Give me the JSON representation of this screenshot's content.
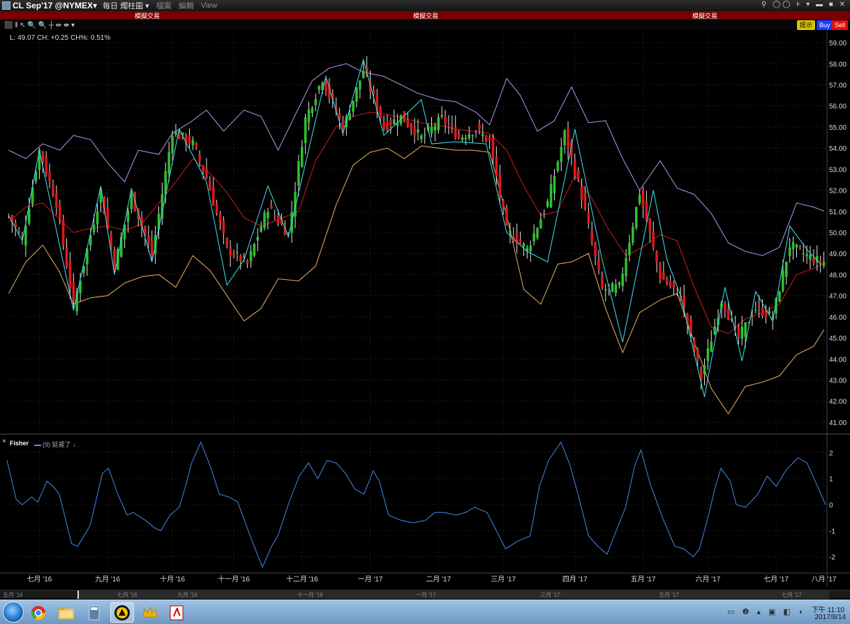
{
  "window": {
    "symbol": "CL Sep'17 @NYMEX▾",
    "chart_type_menu": "每日 燭柱圖 ▾",
    "menu": [
      "檔案",
      "編輯",
      "View"
    ],
    "controls": "⚲ ◯◯ ⊧ ▾ ▬ ■ ✕"
  },
  "sim_banner": [
    "模擬交易",
    "模擬交易",
    "模擬交易"
  ],
  "toolbar": {
    "tools": "⬛ ⫴ ↖ 🔍 🔍 ┼ ⇹ ⇼ ▾",
    "hint": "提示",
    "buy": "Buy",
    "sell": "Sell"
  },
  "readout": "L: 49.07  CH: +0.25  CH%: 0.51%",
  "indicator": {
    "name": "Fisher",
    "param": "(9) 延遲了 ↓",
    "close": "×"
  },
  "chart_data": [
    {
      "type": "candlestick",
      "ylim": [
        40.5,
        59.5
      ],
      "yticks": [
        "59.00",
        "58.00",
        "57.00",
        "56.00",
        "55.00",
        "54.00",
        "53.00",
        "52.00",
        "51.00",
        "50.00",
        "49.00",
        "48.00",
        "47.00",
        "46.00",
        "45.00",
        "44.00",
        "43.00",
        "42.00",
        "41.00"
      ],
      "xticks": [
        "七月 '16",
        "九月 '16",
        "十月 '16",
        "十一月 '16",
        "十二月 '16",
        "一月 '17",
        "二月 '17",
        "三月 '17",
        "四月 '17",
        "五月 '17",
        "六月 '17",
        "七月 '17",
        "八月 '17"
      ],
      "colors": {
        "up": "#2ec22e",
        "down": "#e01818",
        "mid": "#c01a1a",
        "upper": "#a88ad8",
        "lower": "#d9a55a",
        "zigzag": "#40d0e0"
      },
      "close_anchors": [
        [
          0,
          50.8
        ],
        [
          4,
          49.6
        ],
        [
          9,
          53.9
        ],
        [
          14,
          51.4
        ],
        [
          19,
          46.5
        ],
        [
          27,
          51.9
        ],
        [
          31,
          48.4
        ],
        [
          36,
          51.7
        ],
        [
          42,
          48.9
        ],
        [
          48,
          54.8
        ],
        [
          54,
          54.2
        ],
        [
          58,
          52.6
        ],
        [
          64,
          49.2
        ],
        [
          70,
          48.5
        ],
        [
          76,
          51.2
        ],
        [
          82,
          49.9
        ],
        [
          87,
          55.4
        ],
        [
          92,
          57.3
        ],
        [
          98,
          54.9
        ],
        [
          104,
          57.7
        ],
        [
          110,
          55.0
        ],
        [
          115,
          55.5
        ],
        [
          121,
          54.5
        ],
        [
          127,
          55.4
        ],
        [
          132,
          54.5
        ],
        [
          137,
          54.9
        ],
        [
          141,
          54.3
        ],
        [
          146,
          50.1
        ],
        [
          152,
          49.2
        ],
        [
          158,
          51.4
        ],
        [
          163,
          54.7
        ],
        [
          168,
          51.7
        ],
        [
          174,
          47.3
        ],
        [
          179,
          47.4
        ],
        [
          185,
          51.9
        ],
        [
          191,
          47.9
        ],
        [
          197,
          47.0
        ],
        [
          203,
          43.1
        ],
        [
          209,
          46.8
        ],
        [
          214,
          45.0
        ],
        [
          219,
          46.4
        ],
        [
          224,
          46.0
        ],
        [
          229,
          49.4
        ],
        [
          234,
          48.9
        ],
        [
          238,
          48.6
        ]
      ],
      "upper_band": [
        [
          0,
          53.9
        ],
        [
          5,
          53.5
        ],
        [
          10,
          54.2
        ],
        [
          15,
          53.9
        ],
        [
          19,
          54.6
        ],
        [
          24,
          54.4
        ],
        [
          29,
          53.3
        ],
        [
          34,
          52.4
        ],
        [
          38,
          53.9
        ],
        [
          44,
          53.7
        ],
        [
          48,
          54.7
        ],
        [
          53,
          55.2
        ],
        [
          58,
          55.8
        ],
        [
          63,
          54.8
        ],
        [
          69,
          55.8
        ],
        [
          74,
          55.5
        ],
        [
          79,
          53.9
        ],
        [
          85,
          55.9
        ],
        [
          89,
          57.2
        ],
        [
          94,
          57.8
        ],
        [
          99,
          58.0
        ],
        [
          104,
          57.6
        ],
        [
          110,
          57.4
        ],
        [
          115,
          57.0
        ],
        [
          120,
          56.6
        ],
        [
          126,
          56.3
        ],
        [
          131,
          56.2
        ],
        [
          137,
          55.7
        ],
        [
          141,
          55.1
        ],
        [
          146,
          57.3
        ],
        [
          150,
          56.5
        ],
        [
          155,
          54.8
        ],
        [
          160,
          55.3
        ],
        [
          165,
          56.9
        ],
        [
          170,
          55.2
        ],
        [
          175,
          55.3
        ],
        [
          180,
          53.5
        ],
        [
          185,
          52.0
        ],
        [
          191,
          53.4
        ],
        [
          196,
          52.1
        ],
        [
          201,
          51.8
        ],
        [
          206,
          50.9
        ],
        [
          211,
          49.5
        ],
        [
          216,
          49.1
        ],
        [
          221,
          48.9
        ],
        [
          226,
          49.3
        ],
        [
          231,
          51.4
        ],
        [
          236,
          51.2
        ],
        [
          241,
          50.9
        ]
      ],
      "lower_band": [
        [
          0,
          47.1
        ],
        [
          5,
          48.6
        ],
        [
          10,
          49.4
        ],
        [
          15,
          48.1
        ],
        [
          19,
          46.6
        ],
        [
          24,
          46.9
        ],
        [
          29,
          47.0
        ],
        [
          34,
          47.6
        ],
        [
          39,
          47.9
        ],
        [
          44,
          48.0
        ],
        [
          49,
          47.4
        ],
        [
          54,
          48.9
        ],
        [
          59,
          48.2
        ],
        [
          64,
          47.0
        ],
        [
          69,
          45.8
        ],
        [
          74,
          46.4
        ],
        [
          79,
          47.8
        ],
        [
          85,
          47.7
        ],
        [
          90,
          48.4
        ],
        [
          96,
          51.3
        ],
        [
          101,
          53.2
        ],
        [
          106,
          53.8
        ],
        [
          111,
          54.0
        ],
        [
          116,
          53.5
        ],
        [
          121,
          54.1
        ],
        [
          126,
          54.0
        ],
        [
          131,
          53.9
        ],
        [
          136,
          53.9
        ],
        [
          141,
          53.8
        ],
        [
          146,
          50.8
        ],
        [
          151,
          47.3
        ],
        [
          156,
          46.6
        ],
        [
          161,
          48.5
        ],
        [
          165,
          48.6
        ],
        [
          170,
          49.0
        ],
        [
          175,
          46.4
        ],
        [
          180,
          44.3
        ],
        [
          185,
          46.2
        ],
        [
          191,
          46.8
        ],
        [
          196,
          47.1
        ],
        [
          201,
          44.8
        ],
        [
          206,
          42.6
        ],
        [
          211,
          41.4
        ],
        [
          216,
          42.7
        ],
        [
          221,
          42.9
        ],
        [
          226,
          43.2
        ],
        [
          231,
          44.2
        ],
        [
          236,
          44.6
        ],
        [
          241,
          45.9
        ]
      ],
      "mid_band": [
        [
          0,
          50.5
        ],
        [
          5,
          51.2
        ],
        [
          10,
          51.4
        ],
        [
          15,
          50.6
        ],
        [
          19,
          50.0
        ],
        [
          24,
          50.2
        ],
        [
          29,
          50.3
        ],
        [
          34,
          50.1
        ],
        [
          39,
          50.4
        ],
        [
          44,
          51.4
        ],
        [
          49,
          52.4
        ],
        [
          54,
          53.5
        ],
        [
          59,
          52.8
        ],
        [
          64,
          51.9
        ],
        [
          69,
          50.7
        ],
        [
          74,
          50.3
        ],
        [
          79,
          50.6
        ],
        [
          85,
          51.0
        ],
        [
          90,
          53.4
        ],
        [
          96,
          55.0
        ],
        [
          101,
          55.5
        ],
        [
          106,
          55.7
        ],
        [
          111,
          55.6
        ],
        [
          116,
          55.4
        ],
        [
          121,
          55.2
        ],
        [
          126,
          55.1
        ],
        [
          131,
          54.9
        ],
        [
          136,
          54.8
        ],
        [
          141,
          54.7
        ],
        [
          146,
          53.9
        ],
        [
          151,
          52.2
        ],
        [
          156,
          50.8
        ],
        [
          161,
          51.0
        ],
        [
          166,
          52.7
        ],
        [
          171,
          51.6
        ],
        [
          176,
          50.1
        ],
        [
          181,
          48.9
        ],
        [
          186,
          49.3
        ],
        [
          191,
          49.9
        ],
        [
          196,
          49.6
        ],
        [
          201,
          47.4
        ],
        [
          206,
          45.5
        ],
        [
          211,
          45.2
        ],
        [
          216,
          45.9
        ],
        [
          221,
          46.2
        ],
        [
          226,
          46.6
        ],
        [
          231,
          48.0
        ],
        [
          236,
          48.3
        ],
        [
          241,
          48.7
        ]
      ],
      "zigzag": [
        [
          0,
          50.8
        ],
        [
          4,
          49.6
        ],
        [
          9,
          53.9
        ],
        [
          19,
          46.3
        ],
        [
          27,
          52.2
        ],
        [
          31,
          48.0
        ],
        [
          36,
          52.1
        ],
        [
          42,
          48.6
        ],
        [
          50,
          54.9
        ],
        [
          58,
          52.4
        ],
        [
          64,
          47.5
        ],
        [
          69,
          48.7
        ],
        [
          76,
          52.2
        ],
        [
          82,
          49.8
        ],
        [
          93,
          57.4
        ],
        [
          98,
          54.7
        ],
        [
          104,
          58.2
        ],
        [
          110,
          54.6
        ],
        [
          121,
          56.3
        ],
        [
          124,
          54.2
        ],
        [
          131,
          54.3
        ],
        [
          140,
          54.2
        ],
        [
          146,
          50.0
        ],
        [
          152,
          49.1
        ],
        [
          158,
          48.6
        ],
        [
          166,
          54.9
        ],
        [
          174,
          48.7
        ],
        [
          180,
          44.8
        ],
        [
          189,
          52.0
        ],
        [
          193,
          48.7
        ],
        [
          197,
          47.0
        ],
        [
          204,
          42.2
        ],
        [
          210,
          47.4
        ],
        [
          215,
          43.9
        ],
        [
          219,
          47.2
        ],
        [
          224,
          45.8
        ],
        [
          229,
          50.3
        ],
        [
          234,
          49.2
        ],
        [
          238,
          48.5
        ]
      ]
    },
    {
      "type": "line",
      "ylim": [
        -2.6,
        2.6
      ],
      "yticks": [
        "2",
        "1",
        "0",
        "-1",
        "-2"
      ],
      "series": [
        {
          "color": "#3a7fd6",
          "values_anchors": [
            [
              0,
              1.7
            ],
            [
              3,
              0.2
            ],
            [
              5,
              0.0
            ],
            [
              8,
              0.3
            ],
            [
              10,
              0.1
            ],
            [
              13,
              0.9
            ],
            [
              15,
              0.7
            ],
            [
              17,
              0.4
            ],
            [
              21,
              -1.5
            ],
            [
              23,
              -1.6
            ],
            [
              27,
              -0.8
            ],
            [
              31,
              1.2
            ],
            [
              33,
              1.4
            ],
            [
              36,
              0.4
            ],
            [
              39,
              -0.4
            ],
            [
              41,
              -0.3
            ],
            [
              45,
              -0.6
            ],
            [
              48,
              -0.9
            ],
            [
              50,
              -1.0
            ],
            [
              53,
              -0.4
            ],
            [
              56,
              -0.1
            ],
            [
              58,
              0.7
            ],
            [
              60,
              1.6
            ],
            [
              63,
              2.4
            ],
            [
              66,
              1.5
            ],
            [
              69,
              0.4
            ],
            [
              72,
              0.3
            ],
            [
              75,
              0.1
            ],
            [
              79,
              -1.2
            ],
            [
              83,
              -2.4
            ],
            [
              86,
              -1.6
            ],
            [
              88,
              -1.2
            ],
            [
              92,
              0.2
            ],
            [
              95,
              1.1
            ],
            [
              98,
              1.6
            ],
            [
              101,
              1.0
            ],
            [
              104,
              1.7
            ],
            [
              107,
              1.6
            ],
            [
              110,
              1.2
            ],
            [
              113,
              0.6
            ],
            [
              116,
              0.4
            ],
            [
              119,
              1.3
            ],
            [
              121,
              0.9
            ],
            [
              124,
              -0.4
            ],
            [
              128,
              -0.6
            ],
            [
              132,
              -0.7
            ],
            [
              136,
              -0.6
            ],
            [
              139,
              -0.3
            ],
            [
              142,
              -0.3
            ],
            [
              146,
              -0.4
            ],
            [
              149,
              -0.3
            ],
            [
              152,
              -0.1
            ],
            [
              156,
              -0.3
            ],
            [
              159,
              -1.0
            ],
            [
              162,
              -1.7
            ],
            [
              166,
              -1.4
            ],
            [
              170,
              -1.2
            ],
            [
              173,
              0.7
            ],
            [
              176,
              1.7
            ],
            [
              180,
              2.4
            ],
            [
              183,
              1.5
            ],
            [
              186,
              0.2
            ],
            [
              189,
              -1.2
            ],
            [
              192,
              -1.6
            ],
            [
              195,
              -1.9
            ],
            [
              197,
              -1.3
            ],
            [
              201,
              -0.1
            ],
            [
              204,
              1.5
            ],
            [
              206,
              2.1
            ],
            [
              209,
              0.8
            ],
            [
              213,
              -0.5
            ],
            [
              217,
              -1.6
            ],
            [
              220,
              -1.7
            ],
            [
              223,
              -2.0
            ],
            [
              225,
              -1.7
            ],
            [
              228,
              -0.4
            ],
            [
              230,
              0.6
            ],
            [
              232,
              1.4
            ],
            [
              235,
              0.9
            ],
            [
              237,
              0.0
            ],
            [
              240,
              -0.1
            ],
            [
              244,
              0.4
            ],
            [
              247,
              1.1
            ],
            [
              250,
              0.7
            ],
            [
              253,
              1.3
            ],
            [
              257,
              1.8
            ],
            [
              260,
              1.6
            ],
            [
              263,
              0.8
            ],
            [
              266,
              0.0
            ]
          ]
        }
      ]
    }
  ],
  "scrollbar_labels": [
    "五月 '16",
    "七月 '16",
    "九月 '16",
    "十一月 '16",
    "一月 '17",
    "三月 '17",
    "五月 '17",
    "七月 '17"
  ],
  "taskbar": {
    "time": "下午 11:10",
    "date": "2017/8/14"
  }
}
